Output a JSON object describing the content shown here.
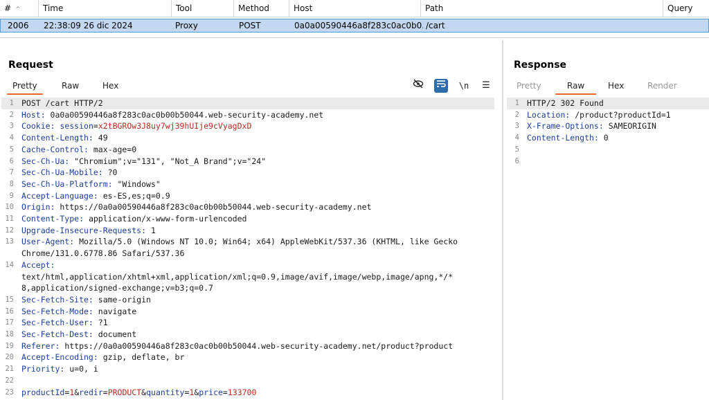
{
  "history": {
    "columns": [
      "#",
      "Time",
      "Tool",
      "Method",
      "Host",
      "Path",
      "Query"
    ],
    "row": {
      "num": "2006",
      "time": "22:38:09 26 dic 2024",
      "tool": "Proxy",
      "method": "POST",
      "host": "0a0a00590446a8f283c0ac0b0...",
      "path": "/cart"
    }
  },
  "request": {
    "title": "Request",
    "tabs": [
      "Pretty",
      "Raw",
      "Hex"
    ],
    "tool_newline": "\\n",
    "tool_menu": "☰",
    "lines": [
      {
        "n": "1",
        "t": "POST /cart HTTP/2"
      },
      {
        "n": "2",
        "k": "Host:",
        "v": " 0a0a00590446a8f283c0ac0b00b50044.web-security-academy.net"
      },
      {
        "n": "3",
        "k": "Cookie:",
        "v": " ",
        "ck": "session",
        "eq": "=",
        "cv": "x2tBGROw3J8uy7wj39hUIje9cVyagDxD"
      },
      {
        "n": "4",
        "k": "Content-Length:",
        "v": " 49"
      },
      {
        "n": "5",
        "k": "Cache-Control:",
        "v": " max-age=0"
      },
      {
        "n": "6",
        "k": "Sec-Ch-Ua:",
        "v": " \"Chromium\";v=\"131\", \"Not_A Brand\";v=\"24\""
      },
      {
        "n": "7",
        "k": "Sec-Ch-Ua-Mobile:",
        "v": " ?0"
      },
      {
        "n": "8",
        "k": "Sec-Ch-Ua-Platform:",
        "v": " \"Windows\""
      },
      {
        "n": "9",
        "k": "Accept-Language:",
        "v": " es-ES,es;q=0.9"
      },
      {
        "n": "10",
        "k": "Origin:",
        "v": " https://0a0a00590446a8f283c0ac0b00b50044.web-security-academy.net"
      },
      {
        "n": "11",
        "k": "Content-Type:",
        "v": " application/x-www-form-urlencoded"
      },
      {
        "n": "12",
        "k": "Upgrade-Insecure-Requests:",
        "v": " 1"
      },
      {
        "n": "13",
        "k": "User-Agent:",
        "v": " Mozilla/5.0 (Windows NT 10.0; Win64; x64) AppleWebKit/537.36 (KHTML, like Gecko",
        "w": "Chrome/131.0.6778.86 Safari/537.36"
      },
      {
        "n": "14",
        "k": "Accept:",
        "v": "",
        "w": "text/html,application/xhtml+xml,application/xml;q=0.9,image/avif,image/webp,image/apng,*/*",
        "w2": "8,application/signed-exchange;v=b3;q=0.7"
      },
      {
        "n": "15",
        "k": "Sec-Fetch-Site:",
        "v": " same-origin"
      },
      {
        "n": "16",
        "k": "Sec-Fetch-Mode:",
        "v": " navigate"
      },
      {
        "n": "17",
        "k": "Sec-Fetch-User:",
        "v": " ?1"
      },
      {
        "n": "18",
        "k": "Sec-Fetch-Dest:",
        "v": " document"
      },
      {
        "n": "19",
        "k": "Referer:",
        "v": " https://0a0a00590446a8f283c0ac0b00b50044.web-security-academy.net/product?product"
      },
      {
        "n": "20",
        "k": "Accept-Encoding:",
        "v": " gzip, deflate, br"
      },
      {
        "n": "21",
        "k": "Priority:",
        "v": " u=0, i"
      },
      {
        "n": "22",
        "t": ""
      },
      {
        "n": "23",
        "body": [
          [
            "productId",
            "1"
          ],
          [
            "redir",
            "PRODUCT"
          ],
          [
            "quantity",
            "1"
          ],
          [
            "price",
            "133700"
          ]
        ]
      }
    ]
  },
  "response": {
    "title": "Response",
    "tabs": [
      "Pretty",
      "Raw",
      "Hex",
      "Render"
    ],
    "lines": [
      {
        "n": "1",
        "t": "HTTP/2 302 Found"
      },
      {
        "n": "2",
        "k": "Location:",
        "v": " /product?productId=1"
      },
      {
        "n": "3",
        "k": "X-Frame-Options:",
        "v": " SAMEORIGIN"
      },
      {
        "n": "4",
        "k": "Content-Length:",
        "v": " 0"
      },
      {
        "n": "5",
        "t": ""
      },
      {
        "n": "6",
        "t": ""
      }
    ]
  }
}
